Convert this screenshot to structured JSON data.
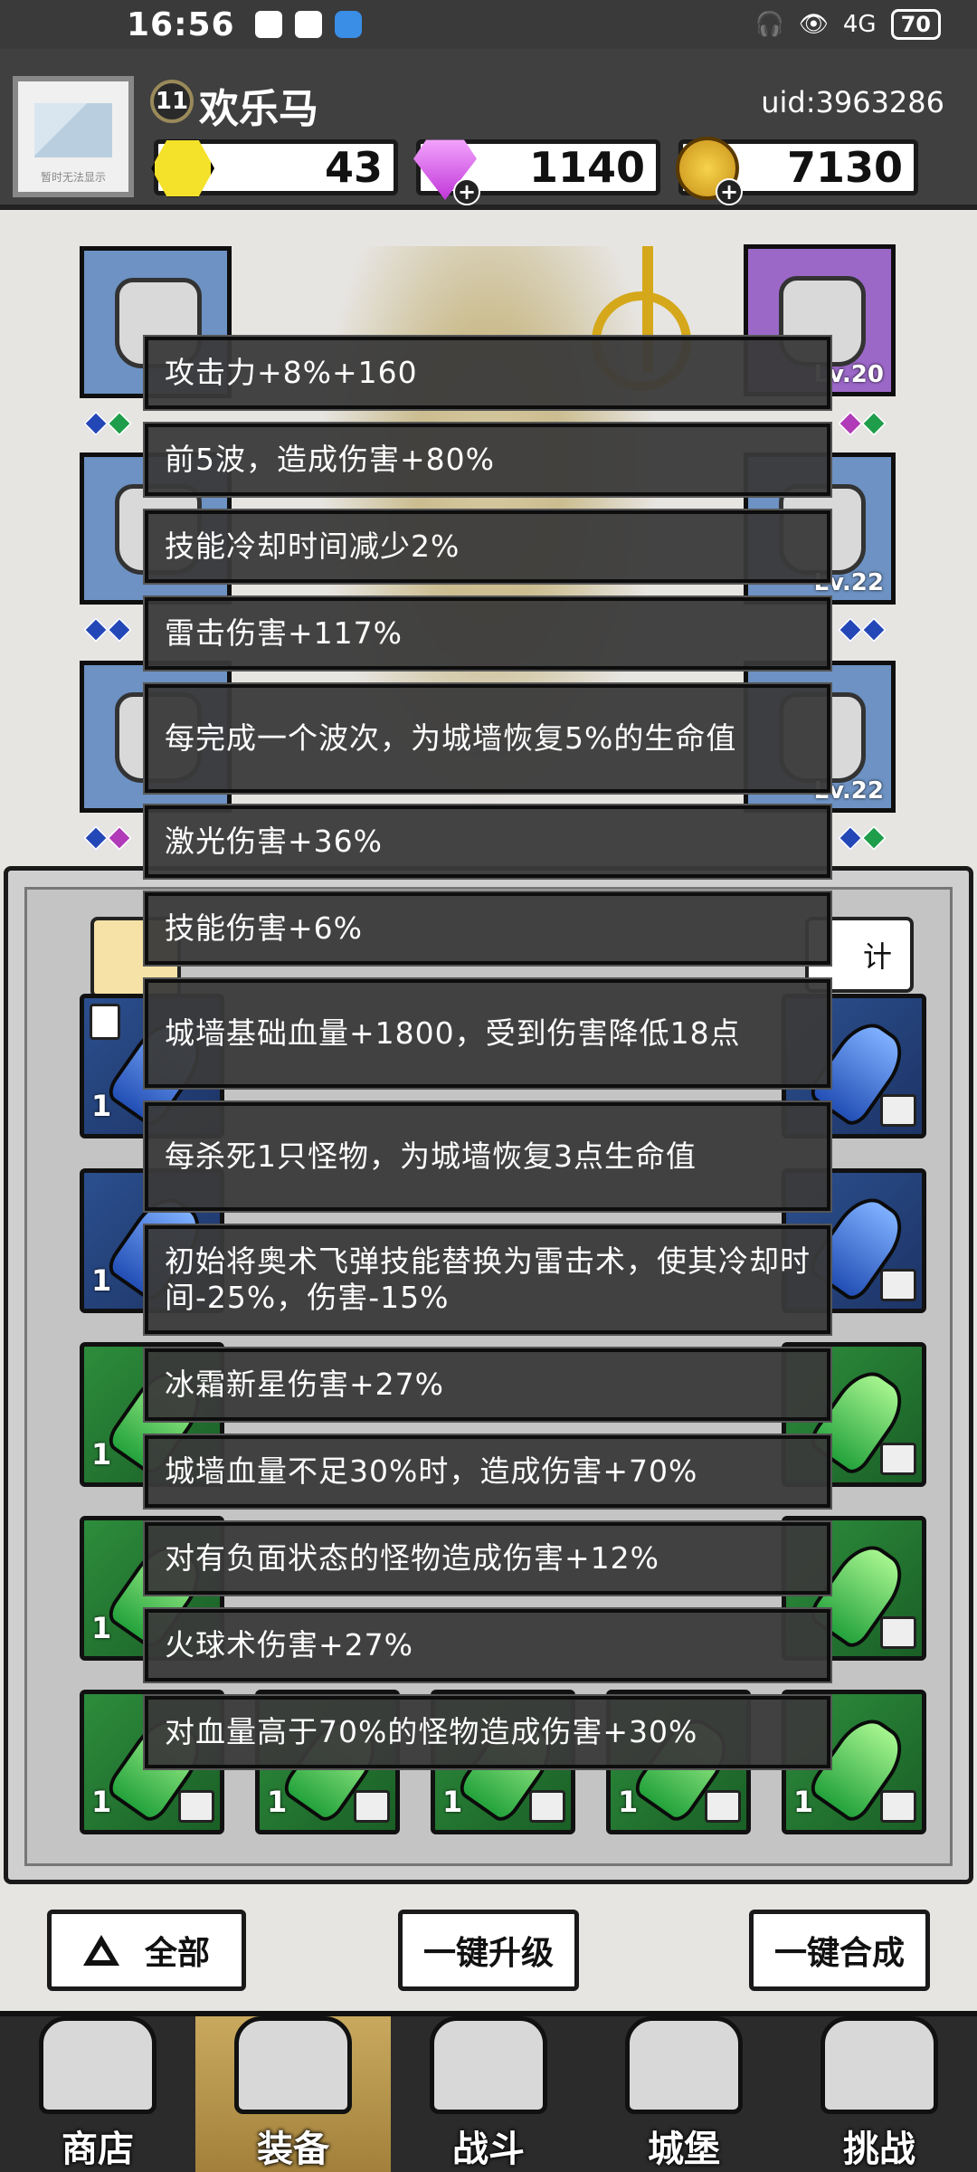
{
  "status_bar": {
    "time": "16:56",
    "network": "4G",
    "battery": "70"
  },
  "player": {
    "level": "11",
    "name": "欢乐马",
    "uid": "uid:3963286",
    "avatar_placeholder": "暂时无法显示"
  },
  "currencies": [
    {
      "icon": "yellow-hexagon-icon",
      "value": "43"
    },
    {
      "icon": "pink-diamond-icon",
      "value": "1140"
    },
    {
      "icon": "gold-coin-icon",
      "value": "7130"
    }
  ],
  "equipment": {
    "right_levels": [
      "Lv.20",
      "Lv.22",
      "Lv.22"
    ]
  },
  "inventory": {
    "stats_button": "计"
  },
  "tooltip": {
    "lines": [
      "攻击力+8%+160",
      "前5波，造成伤害+80%",
      "技能冷却时间减少2%",
      "雷击伤害+117%",
      "每完成一个波次，为城墙恢复5%的生命值",
      "激光伤害+36%",
      "技能伤害+6%",
      "城墙基础血量+1800，受到伤害降低18点",
      "每杀死1只怪物，为城墙恢复3点生命值",
      "初始将奥术飞弹技能替换为雷击术，使其冷却时间-25%，伤害-15%",
      "冰霜新星伤害+27%",
      "城墙血量不足30%时，造成伤害+70%",
      "对有负面状态的怪物造成伤害+12%",
      "火球术伤害+27%",
      "对血量高于70%的怪物造成伤害+30%"
    ]
  },
  "cards": {
    "count_label": "1"
  },
  "actions": {
    "all": "全部",
    "upgrade_all": "一键升级",
    "merge_all": "一键合成"
  },
  "tabs": [
    {
      "label": "商店",
      "icon": "shop-icon"
    },
    {
      "label": "装备",
      "icon": "backpack-icon",
      "active": true
    },
    {
      "label": "战斗",
      "icon": "crossed-swords-icon"
    },
    {
      "label": "城堡",
      "icon": "castle-icon"
    },
    {
      "label": "挑战",
      "icon": "challenge-lock-icon"
    }
  ]
}
